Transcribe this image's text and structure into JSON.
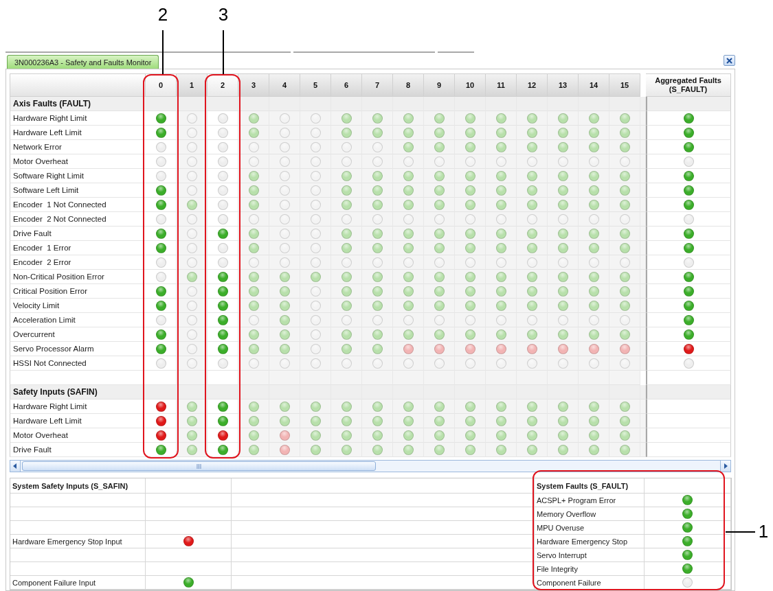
{
  "tab": {
    "title": "3N000236A3 - Safety and Faults Monitor",
    "selected": true
  },
  "axes": [
    {
      "label": "0",
      "enabled": true
    },
    {
      "label": "1",
      "enabled": false
    },
    {
      "label": "2",
      "enabled": true
    },
    {
      "label": "3",
      "enabled": false
    },
    {
      "label": "4",
      "enabled": false
    },
    {
      "label": "5",
      "enabled": false
    },
    {
      "label": "6",
      "enabled": false
    },
    {
      "label": "7",
      "enabled": false
    },
    {
      "label": "8",
      "enabled": false
    },
    {
      "label": "9",
      "enabled": false
    },
    {
      "label": "10",
      "enabled": false
    },
    {
      "label": "11",
      "enabled": false
    },
    {
      "label": "12",
      "enabled": false
    },
    {
      "label": "13",
      "enabled": false
    },
    {
      "label": "14",
      "enabled": false
    },
    {
      "label": "15",
      "enabled": false
    }
  ],
  "aggregated_header": "Aggregated Faults (S_FAULT)",
  "sections": [
    {
      "title": "Axis Faults (FAULT)",
      "rows": [
        {
          "label": "Hardware Right Limit",
          "leds": [
            {
              "color": "#3cae2a"
            },
            {
              "color": "#f3f3f3"
            },
            {
              "color": "#eeeeee"
            },
            {
              "color": "#b8e0ab"
            },
            {
              "color": "#f3f3f3"
            },
            {
              "color": "#f3f3f3"
            },
            {
              "color": "#b8e0ab"
            },
            {
              "color": "#b8e0ab"
            },
            {
              "color": "#b8e0ab"
            },
            {
              "color": "#b8e0ab"
            },
            {
              "color": "#b8e0ab"
            },
            {
              "color": "#b8e0ab"
            },
            {
              "color": "#b8e0ab"
            },
            {
              "color": "#b8e0ab"
            },
            {
              "color": "#b8e0ab"
            },
            {
              "color": "#b8e0ab"
            }
          ],
          "aggregated": {
            "color": "#3cae2a"
          }
        },
        {
          "label": "Hardware Left Limit",
          "leds": [
            {
              "color": "#3cae2a"
            },
            {
              "color": "#f3f3f3"
            },
            {
              "color": "#eeeeee"
            },
            {
              "color": "#b8e0ab"
            },
            {
              "color": "#f3f3f3"
            },
            {
              "color": "#f3f3f3"
            },
            {
              "color": "#b8e0ab"
            },
            {
              "color": "#b8e0ab"
            },
            {
              "color": "#b8e0ab"
            },
            {
              "color": "#b8e0ab"
            },
            {
              "color": "#b8e0ab"
            },
            {
              "color": "#b8e0ab"
            },
            {
              "color": "#b8e0ab"
            },
            {
              "color": "#b8e0ab"
            },
            {
              "color": "#b8e0ab"
            },
            {
              "color": "#b8e0ab"
            }
          ],
          "aggregated": {
            "color": "#3cae2a"
          }
        },
        {
          "label": "Network Error",
          "leds": [
            {
              "color": "#eeeeee"
            },
            {
              "color": "#f3f3f3"
            },
            {
              "color": "#eeeeee"
            },
            {
              "color": "#f3f3f3"
            },
            {
              "color": "#f3f3f3"
            },
            {
              "color": "#f3f3f3"
            },
            {
              "color": "#f3f3f3"
            },
            {
              "color": "#f3f3f3"
            },
            {
              "color": "#b8e0ab"
            },
            {
              "color": "#b8e0ab"
            },
            {
              "color": "#b8e0ab"
            },
            {
              "color": "#b8e0ab"
            },
            {
              "color": "#b8e0ab"
            },
            {
              "color": "#b8e0ab"
            },
            {
              "color": "#b8e0ab"
            },
            {
              "color": "#b8e0ab"
            }
          ],
          "aggregated": {
            "color": "#3cae2a"
          }
        },
        {
          "label": "Motor Overheat",
          "leds": [
            {
              "color": "#eeeeee"
            },
            {
              "color": "#f3f3f3"
            },
            {
              "color": "#eeeeee"
            },
            {
              "color": "#f3f3f3"
            },
            {
              "color": "#f3f3f3"
            },
            {
              "color": "#f3f3f3"
            },
            {
              "color": "#f3f3f3"
            },
            {
              "color": "#f3f3f3"
            },
            {
              "color": "#f3f3f3"
            },
            {
              "color": "#f3f3f3"
            },
            {
              "color": "#f3f3f3"
            },
            {
              "color": "#f3f3f3"
            },
            {
              "color": "#f3f3f3"
            },
            {
              "color": "#f3f3f3"
            },
            {
              "color": "#f3f3f3"
            },
            {
              "color": "#f3f3f3"
            }
          ],
          "aggregated": {
            "color": "#eeeeee"
          }
        },
        {
          "label": "Software Right Limit",
          "leds": [
            {
              "color": "#eeeeee"
            },
            {
              "color": "#f3f3f3"
            },
            {
              "color": "#eeeeee"
            },
            {
              "color": "#b8e0ab"
            },
            {
              "color": "#f3f3f3"
            },
            {
              "color": "#f3f3f3"
            },
            {
              "color": "#b8e0ab"
            },
            {
              "color": "#b8e0ab"
            },
            {
              "color": "#b8e0ab"
            },
            {
              "color": "#b8e0ab"
            },
            {
              "color": "#b8e0ab"
            },
            {
              "color": "#b8e0ab"
            },
            {
              "color": "#b8e0ab"
            },
            {
              "color": "#b8e0ab"
            },
            {
              "color": "#b8e0ab"
            },
            {
              "color": "#b8e0ab"
            }
          ],
          "aggregated": {
            "color": "#3cae2a"
          }
        },
        {
          "label": "Software Left Limit",
          "leds": [
            {
              "color": "#3cae2a"
            },
            {
              "color": "#f3f3f3"
            },
            {
              "color": "#eeeeee"
            },
            {
              "color": "#b8e0ab"
            },
            {
              "color": "#f3f3f3"
            },
            {
              "color": "#f3f3f3"
            },
            {
              "color": "#b8e0ab"
            },
            {
              "color": "#b8e0ab"
            },
            {
              "color": "#b8e0ab"
            },
            {
              "color": "#b8e0ab"
            },
            {
              "color": "#b8e0ab"
            },
            {
              "color": "#b8e0ab"
            },
            {
              "color": "#b8e0ab"
            },
            {
              "color": "#b8e0ab"
            },
            {
              "color": "#b8e0ab"
            },
            {
              "color": "#b8e0ab"
            }
          ],
          "aggregated": {
            "color": "#3cae2a"
          }
        },
        {
          "label": "Encoder  1 Not Connected",
          "leds": [
            {
              "color": "#3cae2a"
            },
            {
              "color": "#b8e0ab"
            },
            {
              "color": "#eeeeee"
            },
            {
              "color": "#b8e0ab"
            },
            {
              "color": "#f3f3f3"
            },
            {
              "color": "#f3f3f3"
            },
            {
              "color": "#b8e0ab"
            },
            {
              "color": "#b8e0ab"
            },
            {
              "color": "#b8e0ab"
            },
            {
              "color": "#b8e0ab"
            },
            {
              "color": "#b8e0ab"
            },
            {
              "color": "#b8e0ab"
            },
            {
              "color": "#b8e0ab"
            },
            {
              "color": "#b8e0ab"
            },
            {
              "color": "#b8e0ab"
            },
            {
              "color": "#b8e0ab"
            }
          ],
          "aggregated": {
            "color": "#3cae2a"
          }
        },
        {
          "label": "Encoder  2 Not Connected",
          "leds": [
            {
              "color": "#eeeeee"
            },
            {
              "color": "#f3f3f3"
            },
            {
              "color": "#eeeeee"
            },
            {
              "color": "#f3f3f3"
            },
            {
              "color": "#f3f3f3"
            },
            {
              "color": "#f3f3f3"
            },
            {
              "color": "#f3f3f3"
            },
            {
              "color": "#f3f3f3"
            },
            {
              "color": "#f3f3f3"
            },
            {
              "color": "#f3f3f3"
            },
            {
              "color": "#f3f3f3"
            },
            {
              "color": "#f3f3f3"
            },
            {
              "color": "#f3f3f3"
            },
            {
              "color": "#f3f3f3"
            },
            {
              "color": "#f3f3f3"
            },
            {
              "color": "#f3f3f3"
            }
          ],
          "aggregated": {
            "color": "#eeeeee"
          }
        },
        {
          "label": "Drive Fault",
          "leds": [
            {
              "color": "#3cae2a"
            },
            {
              "color": "#f3f3f3"
            },
            {
              "color": "#3cae2a"
            },
            {
              "color": "#b8e0ab"
            },
            {
              "color": "#f3f3f3"
            },
            {
              "color": "#f3f3f3"
            },
            {
              "color": "#b8e0ab"
            },
            {
              "color": "#b8e0ab"
            },
            {
              "color": "#b8e0ab"
            },
            {
              "color": "#b8e0ab"
            },
            {
              "color": "#b8e0ab"
            },
            {
              "color": "#b8e0ab"
            },
            {
              "color": "#b8e0ab"
            },
            {
              "color": "#b8e0ab"
            },
            {
              "color": "#b8e0ab"
            },
            {
              "color": "#b8e0ab"
            }
          ],
          "aggregated": {
            "color": "#3cae2a"
          }
        },
        {
          "label": "Encoder  1 Error",
          "leds": [
            {
              "color": "#3cae2a"
            },
            {
              "color": "#f3f3f3"
            },
            {
              "color": "#eeeeee"
            },
            {
              "color": "#b8e0ab"
            },
            {
              "color": "#f3f3f3"
            },
            {
              "color": "#f3f3f3"
            },
            {
              "color": "#b8e0ab"
            },
            {
              "color": "#b8e0ab"
            },
            {
              "color": "#b8e0ab"
            },
            {
              "color": "#b8e0ab"
            },
            {
              "color": "#b8e0ab"
            },
            {
              "color": "#b8e0ab"
            },
            {
              "color": "#b8e0ab"
            },
            {
              "color": "#b8e0ab"
            },
            {
              "color": "#b8e0ab"
            },
            {
              "color": "#b8e0ab"
            }
          ],
          "aggregated": {
            "color": "#3cae2a"
          }
        },
        {
          "label": "Encoder  2 Error",
          "leds": [
            {
              "color": "#eeeeee"
            },
            {
              "color": "#f3f3f3"
            },
            {
              "color": "#eeeeee"
            },
            {
              "color": "#f3f3f3"
            },
            {
              "color": "#f3f3f3"
            },
            {
              "color": "#f3f3f3"
            },
            {
              "color": "#f3f3f3"
            },
            {
              "color": "#f3f3f3"
            },
            {
              "color": "#f3f3f3"
            },
            {
              "color": "#f3f3f3"
            },
            {
              "color": "#f3f3f3"
            },
            {
              "color": "#f3f3f3"
            },
            {
              "color": "#f3f3f3"
            },
            {
              "color": "#f3f3f3"
            },
            {
              "color": "#f3f3f3"
            },
            {
              "color": "#f3f3f3"
            }
          ],
          "aggregated": {
            "color": "#eeeeee"
          }
        },
        {
          "label": "Non-Critical Position Error",
          "leds": [
            {
              "color": "#eeeeee"
            },
            {
              "color": "#b8e0ab"
            },
            {
              "color": "#3cae2a"
            },
            {
              "color": "#b8e0ab"
            },
            {
              "color": "#b8e0ab"
            },
            {
              "color": "#b8e0ab"
            },
            {
              "color": "#b8e0ab"
            },
            {
              "color": "#b8e0ab"
            },
            {
              "color": "#b8e0ab"
            },
            {
              "color": "#b8e0ab"
            },
            {
              "color": "#b8e0ab"
            },
            {
              "color": "#b8e0ab"
            },
            {
              "color": "#b8e0ab"
            },
            {
              "color": "#b8e0ab"
            },
            {
              "color": "#b8e0ab"
            },
            {
              "color": "#b8e0ab"
            }
          ],
          "aggregated": {
            "color": "#3cae2a"
          }
        },
        {
          "label": "Critical Position Error",
          "leds": [
            {
              "color": "#3cae2a"
            },
            {
              "color": "#f3f3f3"
            },
            {
              "color": "#3cae2a"
            },
            {
              "color": "#b8e0ab"
            },
            {
              "color": "#b8e0ab"
            },
            {
              "color": "#f3f3f3"
            },
            {
              "color": "#b8e0ab"
            },
            {
              "color": "#b8e0ab"
            },
            {
              "color": "#b8e0ab"
            },
            {
              "color": "#b8e0ab"
            },
            {
              "color": "#b8e0ab"
            },
            {
              "color": "#b8e0ab"
            },
            {
              "color": "#b8e0ab"
            },
            {
              "color": "#b8e0ab"
            },
            {
              "color": "#b8e0ab"
            },
            {
              "color": "#b8e0ab"
            }
          ],
          "aggregated": {
            "color": "#3cae2a"
          }
        },
        {
          "label": "Velocity Limit",
          "leds": [
            {
              "color": "#3cae2a"
            },
            {
              "color": "#f3f3f3"
            },
            {
              "color": "#3cae2a"
            },
            {
              "color": "#b8e0ab"
            },
            {
              "color": "#b8e0ab"
            },
            {
              "color": "#f3f3f3"
            },
            {
              "color": "#b8e0ab"
            },
            {
              "color": "#b8e0ab"
            },
            {
              "color": "#b8e0ab"
            },
            {
              "color": "#b8e0ab"
            },
            {
              "color": "#b8e0ab"
            },
            {
              "color": "#b8e0ab"
            },
            {
              "color": "#b8e0ab"
            },
            {
              "color": "#b8e0ab"
            },
            {
              "color": "#b8e0ab"
            },
            {
              "color": "#b8e0ab"
            }
          ],
          "aggregated": {
            "color": "#3cae2a"
          }
        },
        {
          "label": "Acceleration Limit",
          "leds": [
            {
              "color": "#eeeeee"
            },
            {
              "color": "#f3f3f3"
            },
            {
              "color": "#3cae2a"
            },
            {
              "color": "#f3f3f3"
            },
            {
              "color": "#b8e0ab"
            },
            {
              "color": "#f3f3f3"
            },
            {
              "color": "#f3f3f3"
            },
            {
              "color": "#f3f3f3"
            },
            {
              "color": "#f3f3f3"
            },
            {
              "color": "#f3f3f3"
            },
            {
              "color": "#f3f3f3"
            },
            {
              "color": "#f3f3f3"
            },
            {
              "color": "#f3f3f3"
            },
            {
              "color": "#f3f3f3"
            },
            {
              "color": "#f3f3f3"
            },
            {
              "color": "#f3f3f3"
            }
          ],
          "aggregated": {
            "color": "#3cae2a"
          }
        },
        {
          "label": "Overcurrent",
          "leds": [
            {
              "color": "#3cae2a"
            },
            {
              "color": "#f3f3f3"
            },
            {
              "color": "#3cae2a"
            },
            {
              "color": "#b8e0ab"
            },
            {
              "color": "#b8e0ab"
            },
            {
              "color": "#f3f3f3"
            },
            {
              "color": "#b8e0ab"
            },
            {
              "color": "#b8e0ab"
            },
            {
              "color": "#b8e0ab"
            },
            {
              "color": "#b8e0ab"
            },
            {
              "color": "#b8e0ab"
            },
            {
              "color": "#b8e0ab"
            },
            {
              "color": "#b8e0ab"
            },
            {
              "color": "#b8e0ab"
            },
            {
              "color": "#b8e0ab"
            },
            {
              "color": "#b8e0ab"
            }
          ],
          "aggregated": {
            "color": "#3cae2a"
          }
        },
        {
          "label": "Servo Processor Alarm",
          "leds": [
            {
              "color": "#3cae2a"
            },
            {
              "color": "#f3f3f3"
            },
            {
              "color": "#3cae2a"
            },
            {
              "color": "#b8e0ab"
            },
            {
              "color": "#b8e0ab"
            },
            {
              "color": "#f3f3f3"
            },
            {
              "color": "#b8e0ab"
            },
            {
              "color": "#b8e0ab"
            },
            {
              "color": "#f2b4b4"
            },
            {
              "color": "#f2b4b4"
            },
            {
              "color": "#f2b4b4"
            },
            {
              "color": "#f2b4b4"
            },
            {
              "color": "#f2b4b4"
            },
            {
              "color": "#f2b4b4"
            },
            {
              "color": "#f2b4b4"
            },
            {
              "color": "#f2b4b4"
            }
          ],
          "aggregated": {
            "color": "#e01a1a"
          }
        },
        {
          "label": "HSSI Not Connected",
          "leds": [
            {
              "color": "#eeeeee"
            },
            {
              "color": "#f3f3f3"
            },
            {
              "color": "#eeeeee"
            },
            {
              "color": "#f3f3f3"
            },
            {
              "color": "#f3f3f3"
            },
            {
              "color": "#f3f3f3"
            },
            {
              "color": "#f3f3f3"
            },
            {
              "color": "#f3f3f3"
            },
            {
              "color": "#f3f3f3"
            },
            {
              "color": "#f3f3f3"
            },
            {
              "color": "#f3f3f3"
            },
            {
              "color": "#f3f3f3"
            },
            {
              "color": "#f3f3f3"
            },
            {
              "color": "#f3f3f3"
            },
            {
              "color": "#f3f3f3"
            },
            {
              "color": "#f3f3f3"
            }
          ],
          "aggregated": {
            "color": "#eeeeee"
          }
        }
      ]
    },
    {
      "title": "Safety Inputs (SAFIN)",
      "rows": [
        {
          "label": "Hardware Right Limit",
          "leds": [
            {
              "color": "#e01a1a"
            },
            {
              "color": "#b8e0ab"
            },
            {
              "color": "#3cae2a"
            },
            {
              "color": "#b8e0ab"
            },
            {
              "color": "#b8e0ab"
            },
            {
              "color": "#b8e0ab"
            },
            {
              "color": "#b8e0ab"
            },
            {
              "color": "#b8e0ab"
            },
            {
              "color": "#b8e0ab"
            },
            {
              "color": "#b8e0ab"
            },
            {
              "color": "#b8e0ab"
            },
            {
              "color": "#b8e0ab"
            },
            {
              "color": "#b8e0ab"
            },
            {
              "color": "#b8e0ab"
            },
            {
              "color": "#b8e0ab"
            },
            {
              "color": "#b8e0ab"
            }
          ]
        },
        {
          "label": "Hardware Left Limit",
          "leds": [
            {
              "color": "#e01a1a"
            },
            {
              "color": "#b8e0ab"
            },
            {
              "color": "#3cae2a"
            },
            {
              "color": "#b8e0ab"
            },
            {
              "color": "#b8e0ab"
            },
            {
              "color": "#b8e0ab"
            },
            {
              "color": "#b8e0ab"
            },
            {
              "color": "#b8e0ab"
            },
            {
              "color": "#b8e0ab"
            },
            {
              "color": "#b8e0ab"
            },
            {
              "color": "#b8e0ab"
            },
            {
              "color": "#b8e0ab"
            },
            {
              "color": "#b8e0ab"
            },
            {
              "color": "#b8e0ab"
            },
            {
              "color": "#b8e0ab"
            },
            {
              "color": "#b8e0ab"
            }
          ]
        },
        {
          "label": "Motor Overheat",
          "leds": [
            {
              "color": "#e01a1a"
            },
            {
              "color": "#b8e0ab"
            },
            {
              "color": "#e01a1a"
            },
            {
              "color": "#b8e0ab"
            },
            {
              "color": "#f2b4b4"
            },
            {
              "color": "#b8e0ab"
            },
            {
              "color": "#b8e0ab"
            },
            {
              "color": "#b8e0ab"
            },
            {
              "color": "#b8e0ab"
            },
            {
              "color": "#b8e0ab"
            },
            {
              "color": "#b8e0ab"
            },
            {
              "color": "#b8e0ab"
            },
            {
              "color": "#b8e0ab"
            },
            {
              "color": "#b8e0ab"
            },
            {
              "color": "#b8e0ab"
            },
            {
              "color": "#b8e0ab"
            }
          ]
        },
        {
          "label": "Drive Fault",
          "leds": [
            {
              "color": "#3cae2a"
            },
            {
              "color": "#b8e0ab"
            },
            {
              "color": "#3cae2a"
            },
            {
              "color": "#b8e0ab"
            },
            {
              "color": "#f2b4b4"
            },
            {
              "color": "#b8e0ab"
            },
            {
              "color": "#b8e0ab"
            },
            {
              "color": "#b8e0ab"
            },
            {
              "color": "#b8e0ab"
            },
            {
              "color": "#b8e0ab"
            },
            {
              "color": "#b8e0ab"
            },
            {
              "color": "#b8e0ab"
            },
            {
              "color": "#b8e0ab"
            },
            {
              "color": "#b8e0ab"
            },
            {
              "color": "#b8e0ab"
            },
            {
              "color": "#b8e0ab"
            }
          ]
        }
      ]
    }
  ],
  "system_safety_inputs": {
    "title": "System Safety Inputs (S_SAFIN)",
    "rows": [
      {
        "kind": "empty"
      },
      {
        "kind": "empty"
      },
      {
        "kind": "empty"
      },
      {
        "kind": "input",
        "label": "Hardware Emergency Stop Input",
        "led": {
          "color": "#e01a1a"
        }
      },
      {
        "kind": "empty"
      },
      {
        "kind": "empty"
      },
      {
        "kind": "input",
        "label": "Component Failure Input",
        "led": {
          "color": "#3cae2a"
        }
      }
    ]
  },
  "system_faults": {
    "title": "System Faults (S_FAULT)",
    "rows": [
      {
        "label": "ACSPL+ Program Error",
        "led": {
          "color": "#3cae2a"
        }
      },
      {
        "label": "Memory Overflow",
        "led": {
          "color": "#3cae2a"
        }
      },
      {
        "label": "MPU Overuse",
        "led": {
          "color": "#3cae2a"
        }
      },
      {
        "label": "Hardware Emergency Stop",
        "led": {
          "color": "#3cae2a"
        }
      },
      {
        "label": "Servo Interrupt",
        "led": {
          "color": "#3cae2a"
        }
      },
      {
        "label": "File Integrity",
        "led": {
          "color": "#3cae2a"
        }
      },
      {
        "label": "Component Failure",
        "led": {
          "color": "#eeeeee"
        }
      }
    ]
  },
  "callouts": [
    {
      "label": "2"
    },
    {
      "label": "3"
    },
    {
      "label": "1"
    }
  ]
}
